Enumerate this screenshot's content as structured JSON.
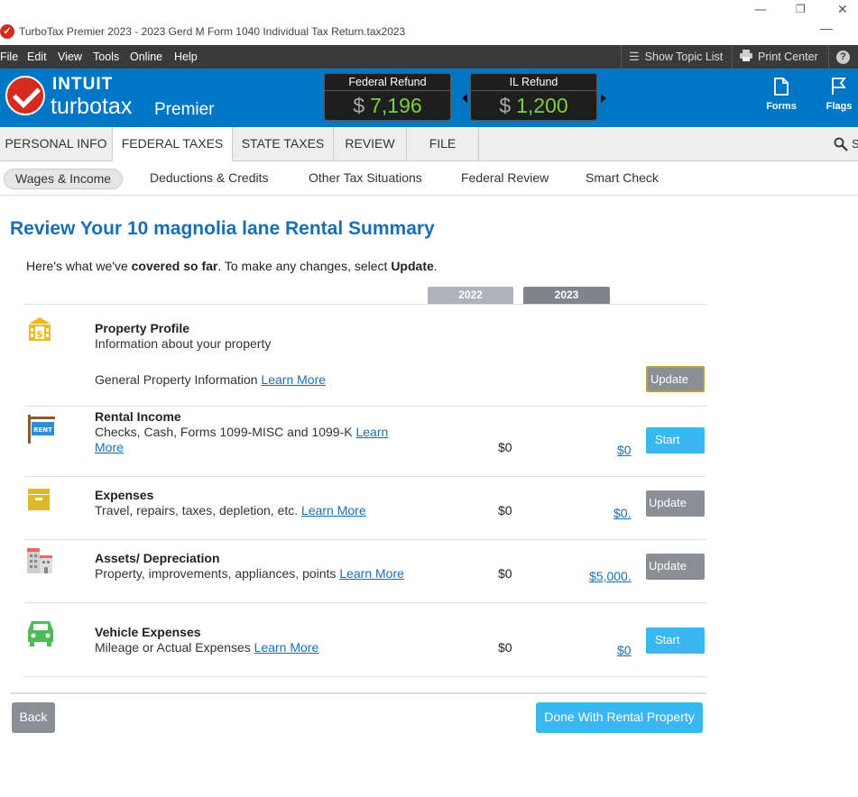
{
  "window": {
    "title": "TurboTax Premier 2023 - 2023 Gerd M Form 1040  Individual Tax Return.tax2023",
    "min_glyph": "—",
    "restore_glyph": "❐",
    "close_glyph": "✕"
  },
  "menu": {
    "items": [
      "File",
      "Edit",
      "View",
      "Tools",
      "Online",
      "Help"
    ],
    "show_topic_list": "Show Topic List",
    "print_center": "Print Center"
  },
  "header": {
    "brand_top": "INTUIT",
    "brand_main": "turbotax",
    "brand_edition": "Premier",
    "federal_label": "Federal Refund",
    "federal_currency": "$",
    "federal_value": "7,196",
    "state_label": "IL Refund",
    "state_currency": "$",
    "state_value": "1,200",
    "forms_label": "Forms",
    "flags_label": "Flags"
  },
  "tabs": [
    "PERSONAL INFO",
    "FEDERAL TAXES",
    "STATE TAXES",
    "REVIEW",
    "FILE"
  ],
  "active_tab": "FEDERAL TAXES",
  "search_partial": "S",
  "subtabs": [
    "Wages & Income",
    "Deductions & Credits",
    "Other Tax Situations",
    "Federal Review",
    "Smart Check"
  ],
  "active_subtab": "Wages & Income",
  "page": {
    "title": "Review Your 10 magnolia lane Rental Summary",
    "intro_pre": "Here's what we've ",
    "intro_bold1": "covered so far",
    "intro_mid": ". To make any changes, select ",
    "intro_bold2": "Update",
    "intro_end": ".",
    "year_2022": "2022",
    "year_2023": "2023"
  },
  "sections": {
    "profile": {
      "title": "Property Profile",
      "desc": "Information about your property",
      "sub": "General Property Information ",
      "learn": "Learn More",
      "button": "Update"
    },
    "income": {
      "title": "Rental Income",
      "desc": "Checks, Cash, Forms 1099-MISC and 1099-K ",
      "learn_a": "Learn",
      "learn_b": "More",
      "v2022": "$0",
      "v2023": "$0",
      "button": "Start",
      "sign_text": "RENT"
    },
    "expenses": {
      "title": "Expenses",
      "desc": "Travel, repairs, taxes, depletion, etc. ",
      "learn": "Learn More",
      "v2022": "$0",
      "v2023": "$0.",
      "button": "Update"
    },
    "assets": {
      "title": "Assets/ Depreciation",
      "desc": "Property, improvements, appliances, points ",
      "learn": "Learn More",
      "v2022": "$0",
      "v2023": "$5,000.",
      "button": "Update"
    },
    "vehicle": {
      "title": "Vehicle Expenses",
      "desc": "Mileage or Actual Expenses ",
      "learn": "Learn More",
      "v2022": "$0",
      "v2023": "$0",
      "button": "Start"
    }
  },
  "footer": {
    "back": "Back",
    "done": "Done With Rental Property"
  },
  "colors": {
    "header_blue": "#0077c5",
    "title_blue": "#1a6fb3",
    "refund_green": "#7bd23b",
    "start_blue": "#3ab6f0",
    "update_gray": "#8a8f95"
  }
}
